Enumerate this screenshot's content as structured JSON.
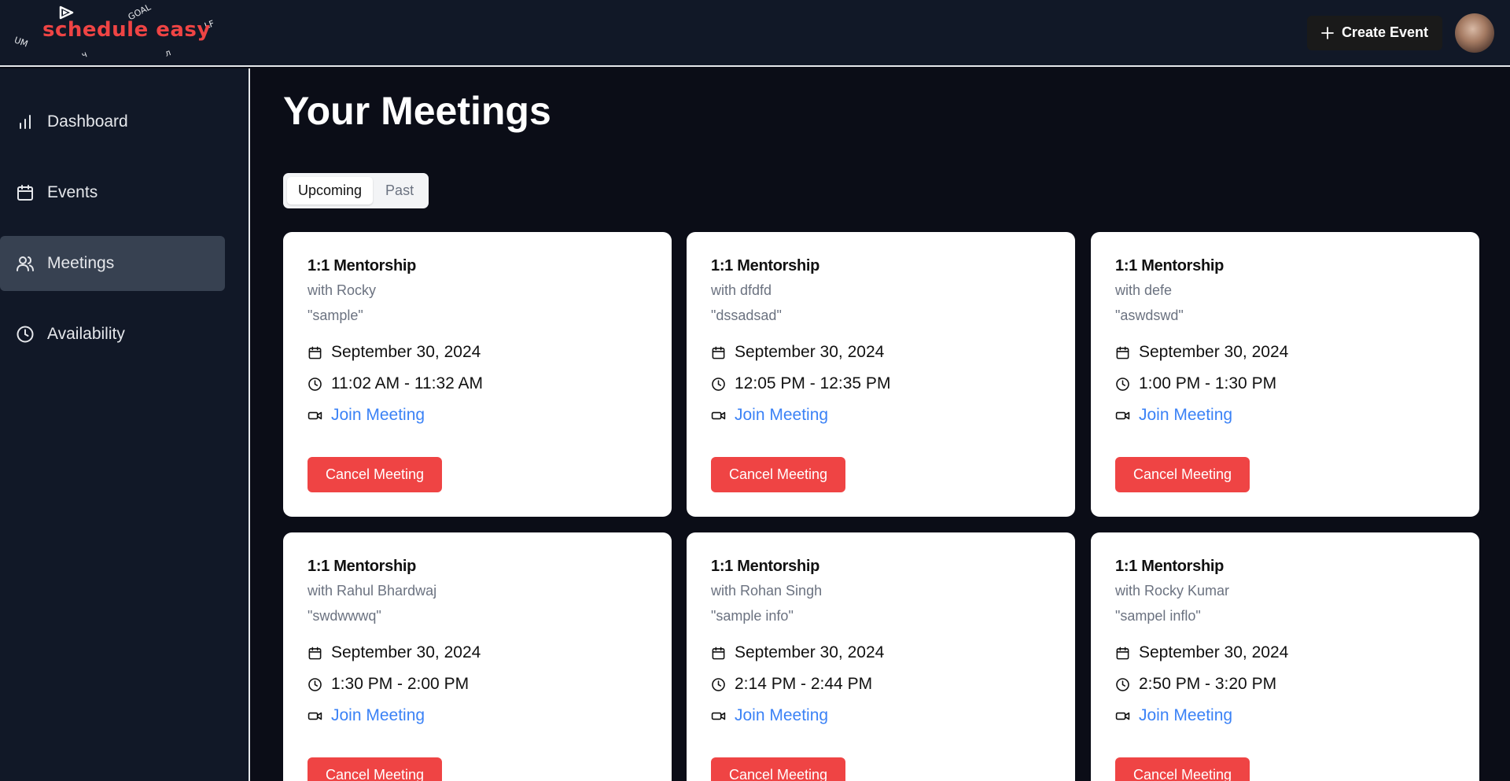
{
  "app": {
    "logo_text": "schedule easy",
    "logo_fragments": [
      "GOAL",
      "UM",
      "LF",
      "ч",
      "л"
    ]
  },
  "header": {
    "create_event_label": "Create Event"
  },
  "sidebar": {
    "items": [
      {
        "label": "Dashboard",
        "icon": "bar-chart-icon"
      },
      {
        "label": "Events",
        "icon": "calendar-icon"
      },
      {
        "label": "Meetings",
        "icon": "users-icon",
        "active": true
      },
      {
        "label": "Availability",
        "icon": "clock-icon"
      }
    ]
  },
  "main": {
    "title": "Your Meetings",
    "tabs": [
      {
        "label": "Upcoming",
        "active": true
      },
      {
        "label": "Past"
      }
    ]
  },
  "meetings": [
    {
      "title": "1:1 Mentorship",
      "with": "with Rocky",
      "note": "\"sample\"",
      "date": "September 30, 2024",
      "time": "11:02 AM - 11:32 AM",
      "join": "Join Meeting",
      "cancel": "Cancel Meeting"
    },
    {
      "title": "1:1 Mentorship",
      "with": "with dfdfd",
      "note": "\"dssadsad\"",
      "date": "September 30, 2024",
      "time": "12:05 PM - 12:35 PM",
      "join": "Join Meeting",
      "cancel": "Cancel Meeting"
    },
    {
      "title": "1:1 Mentorship",
      "with": "with defe",
      "note": "\"aswdswd\"",
      "date": "September 30, 2024",
      "time": "1:00 PM - 1:30 PM",
      "join": "Join Meeting",
      "cancel": "Cancel Meeting"
    },
    {
      "title": "1:1 Mentorship",
      "with": "with Rahul Bhardwaj",
      "note": "\"swdwwwq\"",
      "date": "September 30, 2024",
      "time": "1:30 PM - 2:00 PM",
      "join": "Join Meeting",
      "cancel": "Cancel Meeting"
    },
    {
      "title": "1:1 Mentorship",
      "with": "with Rohan Singh",
      "note": "\"sample info\"",
      "date": "September 30, 2024",
      "time": "2:14 PM - 2:44 PM",
      "join": "Join Meeting",
      "cancel": "Cancel Meeting"
    },
    {
      "title": "1:1 Mentorship",
      "with": "with Rocky Kumar",
      "note": "\"sampel inflo\"",
      "date": "September 30, 2024",
      "time": "2:50 PM - 3:20 PM",
      "join": "Join Meeting",
      "cancel": "Cancel Meeting"
    }
  ],
  "colors": {
    "accent_red": "#ef4444",
    "link_blue": "#3b82f6",
    "sidebar_bg": "#111827",
    "main_bg": "#0b0d17"
  }
}
